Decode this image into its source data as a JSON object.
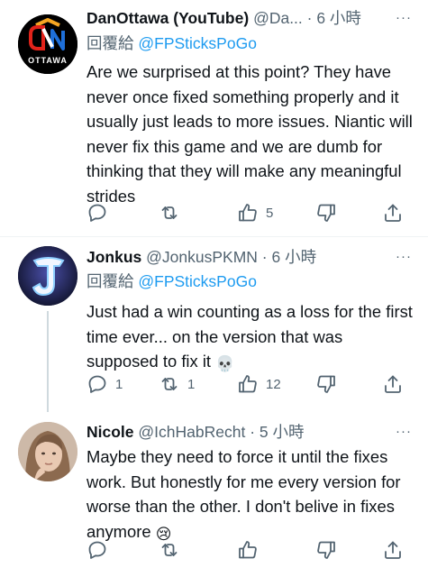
{
  "tweets": [
    {
      "name": "DanOttawa (YouTube)",
      "handle_time": "@Da... · 6 小時",
      "reply_prefix": "回覆給",
      "reply_to": "@FPSticksPoGo",
      "text": "Are we surprised at this point?  They have never once fixed something properly and it usually just leads to more issues.  Niantic will never fix this game and we are dumb for thinking that they will make any meaningful strides",
      "avatar_logo_text": "OTTAWA",
      "actions": {
        "reply": "",
        "retweet": "",
        "like": "5",
        "dislike": "",
        "share": ""
      }
    },
    {
      "name": "Jonkus",
      "handle_time": "@JonkusPKMN · 6 小時",
      "reply_prefix": "回覆給",
      "reply_to": "@FPSticksPoGo",
      "text": "Just had a win counting as a loss for the first time ever... on the version that was supposed to fix it",
      "emoji": "💀",
      "actions": {
        "reply": "1",
        "retweet": "1",
        "like": "12",
        "dislike": "",
        "share": ""
      }
    },
    {
      "name": "Nicole",
      "handle_time": "@IchHabRecht · 5 小時",
      "text": "Maybe they need to force it until the fixes work. But honestly for me every version for worse than the other. I don't belive in fixes anymore",
      "emoji": "😢",
      "actions": {
        "reply": "",
        "retweet": "",
        "like": "",
        "dislike": "",
        "share": ""
      }
    }
  ],
  "more_glyph": "···",
  "colors": {
    "link": "#1d9bf0",
    "secondary": "#536471",
    "primary": "#0f1419",
    "thread_line": "#cfd9de"
  }
}
